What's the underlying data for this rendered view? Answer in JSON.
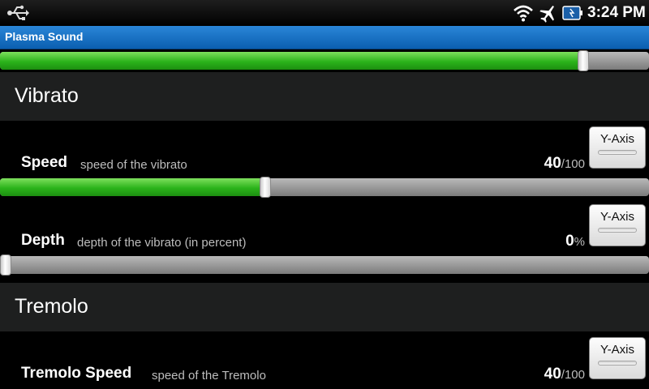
{
  "status_bar": {
    "time": "3:24 PM",
    "icons": [
      "usb-icon",
      "wifi-icon",
      "airplane-mode-icon",
      "battery-icon"
    ]
  },
  "app": {
    "title": "Plasma Sound"
  },
  "colors": {
    "title_bar": "#0b5fb0",
    "slider_fill": "#2bb31b",
    "section_header_bg": "#1e1f1f"
  },
  "top_slider": {
    "level_percent": 89
  },
  "sections": {
    "vibrato": {
      "title": "Vibrato",
      "speed": {
        "label": "Speed",
        "description": "speed of the vibrato",
        "value": "40",
        "unit": "/100",
        "level_percent": 40,
        "y_axis_button": "Y-Axis"
      },
      "depth": {
        "label": "Depth",
        "description": "depth of the vibrato (in percent)",
        "value": "0",
        "unit": "%",
        "level_percent": 0,
        "y_axis_button": "Y-Axis"
      }
    },
    "tremolo": {
      "title": "Tremolo",
      "tremolo_speed": {
        "label": "Tremolo Speed",
        "description": "speed of the Tremolo",
        "value": "40",
        "unit": "/100",
        "y_axis_button": "Y-Axis"
      }
    }
  }
}
